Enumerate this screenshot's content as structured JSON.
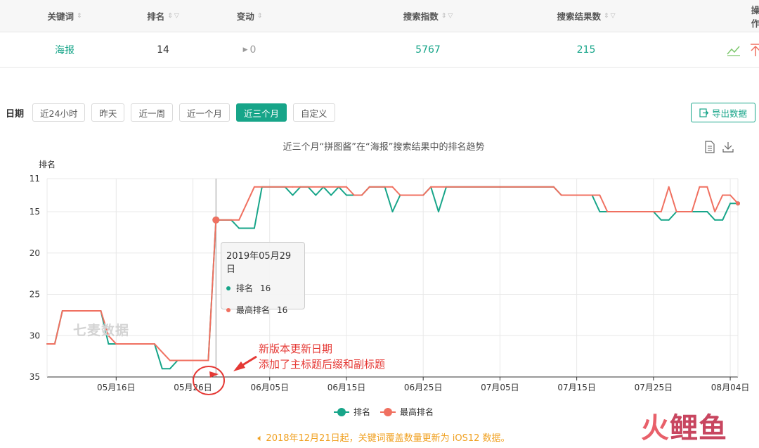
{
  "table": {
    "headers": [
      "关键词",
      "排名",
      "变动",
      "搜索指数",
      "搜索结果数",
      "操作"
    ],
    "row": {
      "keyword": "海报",
      "rank": "14",
      "change": "0",
      "search_index": "5767",
      "result_count": "215"
    }
  },
  "filters": {
    "label": "日期",
    "buttons": [
      "近24小时",
      "昨天",
      "近一周",
      "近一个月",
      "近三个月",
      "自定义"
    ],
    "active": "近三个月",
    "export": "导出数据"
  },
  "chart_title": "近三个月“拼图酱”在“海报”搜索结果中的排名趋势",
  "tooltip": {
    "date": "2019年05月29日",
    "rank_label": "排名",
    "rank_value": "16",
    "best_label": "最高排名",
    "best_value": "16"
  },
  "watermark": "七麦数据",
  "annotation": {
    "line1": "新版本更新日期",
    "line2": "添加了主标题后缀和副标题"
  },
  "notice": "2018年12月21日起，关键词覆盖数量更新为 iOS12 数据。",
  "brand": {
    "part1": "火",
    "part2": "鲤鱼"
  },
  "colors": {
    "rank": "#17a589",
    "best": "#f07060",
    "accent": "#17a589",
    "notice": "#f0a020",
    "annotation": "#e53935"
  },
  "chart_data": {
    "type": "line",
    "ylabel": "排名",
    "y_inverted": true,
    "ylim": [
      11,
      35
    ],
    "yticks": [
      11,
      15,
      20,
      25,
      30,
      35
    ],
    "x_start": "2019-05-07",
    "x_end": "2019-08-05",
    "xticks": [
      {
        "date": "2019-05-16",
        "label": "05月16日"
      },
      {
        "date": "2019-05-26",
        "label": "05月26日"
      },
      {
        "date": "2019-06-05",
        "label": "06月05日"
      },
      {
        "date": "2019-06-15",
        "label": "06月15日"
      },
      {
        "date": "2019-06-25",
        "label": "06月25日"
      },
      {
        "date": "2019-07-05",
        "label": "07月05日"
      },
      {
        "date": "2019-07-15",
        "label": "07月15日"
      },
      {
        "date": "2019-07-25",
        "label": "07月25日"
      },
      {
        "date": "2019-08-04",
        "label": "08月04日"
      }
    ],
    "hover_date": "2019-05-29",
    "series": [
      {
        "name": "排名",
        "color": "#17a589",
        "points": [
          [
            "2019-05-07",
            31
          ],
          [
            "2019-05-08",
            31
          ],
          [
            "2019-05-09",
            27
          ],
          [
            "2019-05-14",
            27
          ],
          [
            "2019-05-15",
            31
          ],
          [
            "2019-05-16",
            31
          ],
          [
            "2019-05-19",
            31
          ],
          [
            "2019-05-21",
            31
          ],
          [
            "2019-05-22",
            34
          ],
          [
            "2019-05-23",
            34
          ],
          [
            "2019-05-24",
            33
          ],
          [
            "2019-05-27",
            33
          ],
          [
            "2019-05-28",
            33
          ],
          [
            "2019-05-29",
            16
          ],
          [
            "2019-05-31",
            16
          ],
          [
            "2019-06-01",
            17
          ],
          [
            "2019-06-03",
            17
          ],
          [
            "2019-06-04",
            12
          ],
          [
            "2019-06-07",
            12
          ],
          [
            "2019-06-08",
            13
          ],
          [
            "2019-06-09",
            12
          ],
          [
            "2019-06-10",
            12
          ],
          [
            "2019-06-11",
            13
          ],
          [
            "2019-06-12",
            12
          ],
          [
            "2019-06-13",
            13
          ],
          [
            "2019-06-14",
            12
          ],
          [
            "2019-06-15",
            13
          ],
          [
            "2019-06-17",
            13
          ],
          [
            "2019-06-18",
            12
          ],
          [
            "2019-06-20",
            12
          ],
          [
            "2019-06-21",
            15
          ],
          [
            "2019-06-22",
            13
          ],
          [
            "2019-06-25",
            13
          ],
          [
            "2019-06-26",
            12
          ],
          [
            "2019-06-27",
            15
          ],
          [
            "2019-06-28",
            12
          ],
          [
            "2019-07-05",
            12
          ],
          [
            "2019-07-12",
            12
          ],
          [
            "2019-07-13",
            13
          ],
          [
            "2019-07-15",
            13
          ],
          [
            "2019-07-17",
            13
          ],
          [
            "2019-07-18",
            15
          ],
          [
            "2019-07-19",
            15
          ],
          [
            "2019-07-25",
            15
          ],
          [
            "2019-07-26",
            16
          ],
          [
            "2019-07-27",
            16
          ],
          [
            "2019-07-28",
            15
          ],
          [
            "2019-08-01",
            15
          ],
          [
            "2019-08-02",
            16
          ],
          [
            "2019-08-03",
            16
          ],
          [
            "2019-08-04",
            14
          ],
          [
            "2019-08-05",
            14
          ]
        ]
      },
      {
        "name": "最高排名",
        "color": "#f07060",
        "points": [
          [
            "2019-05-07",
            31
          ],
          [
            "2019-05-08",
            31
          ],
          [
            "2019-05-09",
            27
          ],
          [
            "2019-05-14",
            27
          ],
          [
            "2019-05-15",
            30
          ],
          [
            "2019-05-16",
            31
          ],
          [
            "2019-05-19",
            31
          ],
          [
            "2019-05-21",
            31
          ],
          [
            "2019-05-22",
            32
          ],
          [
            "2019-05-23",
            33
          ],
          [
            "2019-05-27",
            33
          ],
          [
            "2019-05-28",
            33
          ],
          [
            "2019-05-29",
            16
          ],
          [
            "2019-05-31",
            16
          ],
          [
            "2019-06-01",
            16
          ],
          [
            "2019-06-03",
            12
          ],
          [
            "2019-06-04",
            12
          ],
          [
            "2019-06-08",
            12
          ],
          [
            "2019-06-09",
            12
          ],
          [
            "2019-06-15",
            12
          ],
          [
            "2019-06-16",
            13
          ],
          [
            "2019-06-17",
            13
          ],
          [
            "2019-06-18",
            12
          ],
          [
            "2019-06-21",
            12
          ],
          [
            "2019-06-22",
            13
          ],
          [
            "2019-06-25",
            13
          ],
          [
            "2019-06-26",
            12
          ],
          [
            "2019-07-05",
            12
          ],
          [
            "2019-07-12",
            12
          ],
          [
            "2019-07-13",
            13
          ],
          [
            "2019-07-15",
            13
          ],
          [
            "2019-07-18",
            13
          ],
          [
            "2019-07-19",
            15
          ],
          [
            "2019-07-25",
            15
          ],
          [
            "2019-07-26",
            15
          ],
          [
            "2019-07-27",
            12
          ],
          [
            "2019-07-28",
            15
          ],
          [
            "2019-07-30",
            15
          ],
          [
            "2019-07-31",
            12
          ],
          [
            "2019-08-01",
            12
          ],
          [
            "2019-08-02",
            15
          ],
          [
            "2019-08-03",
            13
          ],
          [
            "2019-08-04",
            13
          ],
          [
            "2019-08-05",
            14
          ]
        ]
      }
    ]
  }
}
